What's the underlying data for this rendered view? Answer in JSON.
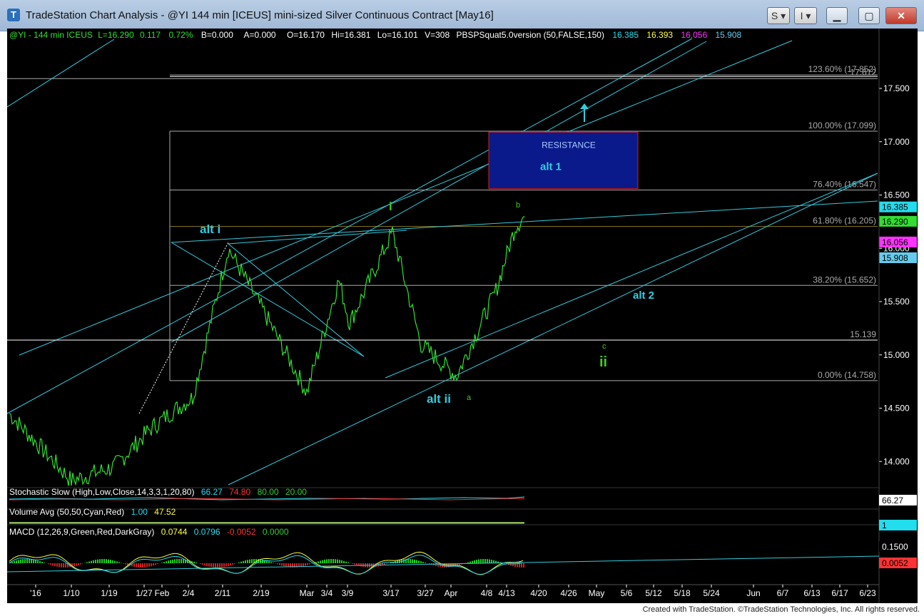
{
  "window": {
    "title": "TradeStation Chart Analysis - @YI 144 min [ICEUS] mini-sized Silver Continuous Contract [May16]",
    "app_icon": "tradestation-logo-icon",
    "menu_s_label": "S",
    "menu_i_label": "I",
    "minimize_icon": "minimize-icon",
    "maximize_icon": "maximize-icon",
    "close_icon": "close-icon"
  },
  "colors": {
    "background": "#000000",
    "price": "#33dd33",
    "cyan": "#33ccdd",
    "green_label": "#44cc22",
    "fib": "#aaaaaa",
    "resistance_fill": "#0a1a8a",
    "resistance_border": "#cc2222",
    "pbs1": "#22ddee",
    "pbs2": "#ffff44",
    "pbs3": "#ff33ff",
    "pbs4": "#66ccee"
  },
  "status_line": {
    "symbol": "@YI - 144 min  ICEUS",
    "last": "L=16.290",
    "change": "0.117",
    "change_pct": "0.72%",
    "bid": "B=0.000",
    "ask": "A=0.000",
    "open": "O=16.170",
    "high": "Hi=16.381",
    "low": "Lo=16.101",
    "volume": "V=308",
    "indicator": "PBSPSquat5.0version (50,FALSE,150)",
    "v1": "16.385",
    "v2": "16.393",
    "v3": "16.056",
    "v4": "15.908"
  },
  "chart_data": {
    "type": "line",
    "title": "@YI 144 min [ICEUS] mini-sized Silver Continuous Contract [May16]",
    "y_axis": {
      "ylim": [
        13.78,
        17.85
      ],
      "tick_labels": [
        "17.500",
        "17.000",
        "16.500",
        "16.000",
        "15.500",
        "15.000",
        "14.500",
        "14.000"
      ],
      "tick_values": [
        17.5,
        17.0,
        16.5,
        16.0,
        15.5,
        15.0,
        14.5,
        14.0
      ]
    },
    "x_axis": {
      "tick_labels": [
        "'16",
        "1/10",
        "1/19",
        "1/27",
        "Feb",
        "2/4",
        "2/11",
        "2/19",
        "Mar",
        "3/4",
        "3/9",
        "3/17",
        "3/27",
        "Apr",
        "4/8",
        "4/13",
        "4/20",
        "4/26",
        "May",
        "5/6",
        "5/12",
        "5/18",
        "5/24",
        "Jun",
        "6/7",
        "6/13",
        "6/17",
        "6/23"
      ]
    },
    "price_series": {
      "name": "@YI 144 min",
      "points": [
        [
          "'16",
          14.45
        ],
        [
          "1/10",
          13.82
        ],
        [
          "1/19",
          13.95
        ],
        [
          "1/27",
          14.3
        ],
        [
          "Feb",
          14.45
        ],
        [
          "2/4",
          14.6
        ],
        [
          "2/11",
          16.0
        ],
        [
          "2/19",
          15.4
        ],
        [
          "Mar",
          14.65
        ],
        [
          "3/4",
          15.7
        ],
        [
          "3/9",
          15.3
        ],
        [
          "3/17",
          16.15
        ],
        [
          "3/27",
          15.1
        ],
        [
          "Apr",
          14.8
        ],
        [
          "4/8",
          15.6
        ],
        [
          "4/13",
          16.2
        ],
        [
          "4/17",
          16.3
        ]
      ]
    },
    "fibonacci_levels": [
      {
        "label": "123.60% (17.852)",
        "value": 17.626
      },
      {
        "label": "100.00% (17.099)",
        "value": 17.099
      },
      {
        "label": "76.40% (16.547)",
        "value": 16.547
      },
      {
        "label": "61.80% (16.205)",
        "value": 16.205
      },
      {
        "label": "38.20% (15.652)",
        "value": 15.652
      },
      {
        "label": "15.139",
        "value": 15.139
      },
      {
        "label": "0.00% (14.758)",
        "value": 14.758
      }
    ],
    "extra_line_label": "17.612",
    "resistance_box": {
      "label": "RESISTANCE",
      "sublabel": "alt 1",
      "low": 16.56,
      "high": 17.09
    },
    "wave_labels": {
      "alt_i": "alt i",
      "i": "i",
      "alt_ii": "alt ii",
      "a": "a",
      "b": "b",
      "c": "c",
      "ii": "ii",
      "alt_2": "alt 2",
      "up_arrow_icon": "up-arrow-icon"
    },
    "price_axis_badges": [
      {
        "text": "16.385",
        "value": 16.385,
        "color": "#22ddee"
      },
      {
        "text": "16.290",
        "value": 16.29,
        "color": "#33dd33"
      },
      {
        "text": "16.056",
        "value": 16.056,
        "color": "#ff33ff"
      },
      {
        "text": "15.908",
        "value": 15.908,
        "color": "#66ccee"
      }
    ],
    "indicators": {
      "stochastic": {
        "label": "Stochastic Slow (High,Low,Close,14,3,3,1,20,80)",
        "v1": "66.27",
        "v2": "74.80",
        "v3": "80.00",
        "v4": "20.00",
        "badge": "66.27"
      },
      "volume": {
        "label": "Volume Avg (50,50,Cyan,Red)",
        "v1": "1.00",
        "v2": "47.52",
        "badge": "1"
      },
      "macd": {
        "label": "MACD (12,26,9,Green,Red,DarkGray)",
        "v1": "0.0744",
        "v2": "0.0796",
        "v3": "-0.0052",
        "v4": "0.0000",
        "badge1": "0.1500",
        "badge2": "0.0052"
      }
    },
    "grid": false
  },
  "footer": {
    "text": "Created with TradeStation. ©TradeStation Technologies, Inc. All rights reserved."
  }
}
